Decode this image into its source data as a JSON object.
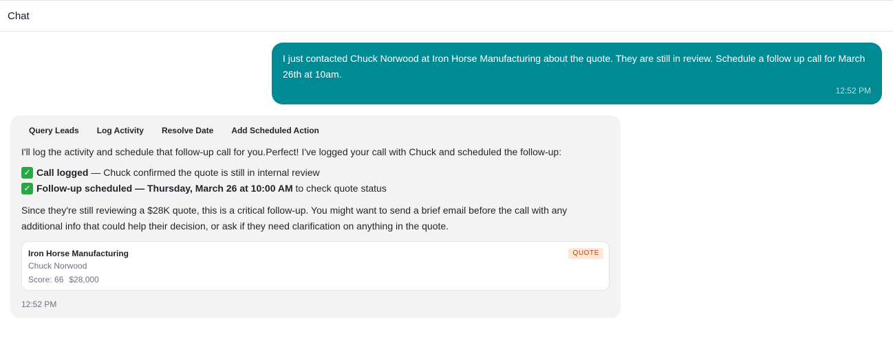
{
  "header": {
    "title": "Chat"
  },
  "user_message": {
    "text": "I just contacted Chuck Norwood at Iron Horse Manufacturing about the quote. They are still in review. Schedule a follow up call for March 26th at 10am.",
    "time": "12:52 PM"
  },
  "assistant_message": {
    "tools": [
      "Query Leads",
      "Log Activity",
      "Resolve Date",
      "Add Scheduled Action"
    ],
    "intro": "I'll log the activity and schedule that follow-up call for you.Perfect! I've logged your call with Chuck and scheduled the follow-up:",
    "checks": [
      {
        "bold": "Call logged",
        "rest": " — Chuck confirmed the quote is still in internal review"
      },
      {
        "bold": "Follow-up scheduled — Thursday, March 26 at 10:00 AM",
        "rest": " to check quote status"
      }
    ],
    "paragraph": "Since they're still reviewing a $28K quote, this is a critical follow-up. You might want to send a brief email before the call with any additional info that could help their decision, or ask if they need clarification on anything in the quote.",
    "lead_card": {
      "company": "Iron Horse Manufacturing",
      "contact": "Chuck Norwood",
      "score": "Score: 66",
      "value": "$28,000",
      "badge": "QUOTE"
    },
    "time": "12:52 PM"
  },
  "colors": {
    "user_bubble": "#008a93",
    "assistant_bubble": "#f3f3f4",
    "badge_bg": "#fde8d7",
    "badge_text": "#c2410c",
    "check": "#28a745"
  }
}
